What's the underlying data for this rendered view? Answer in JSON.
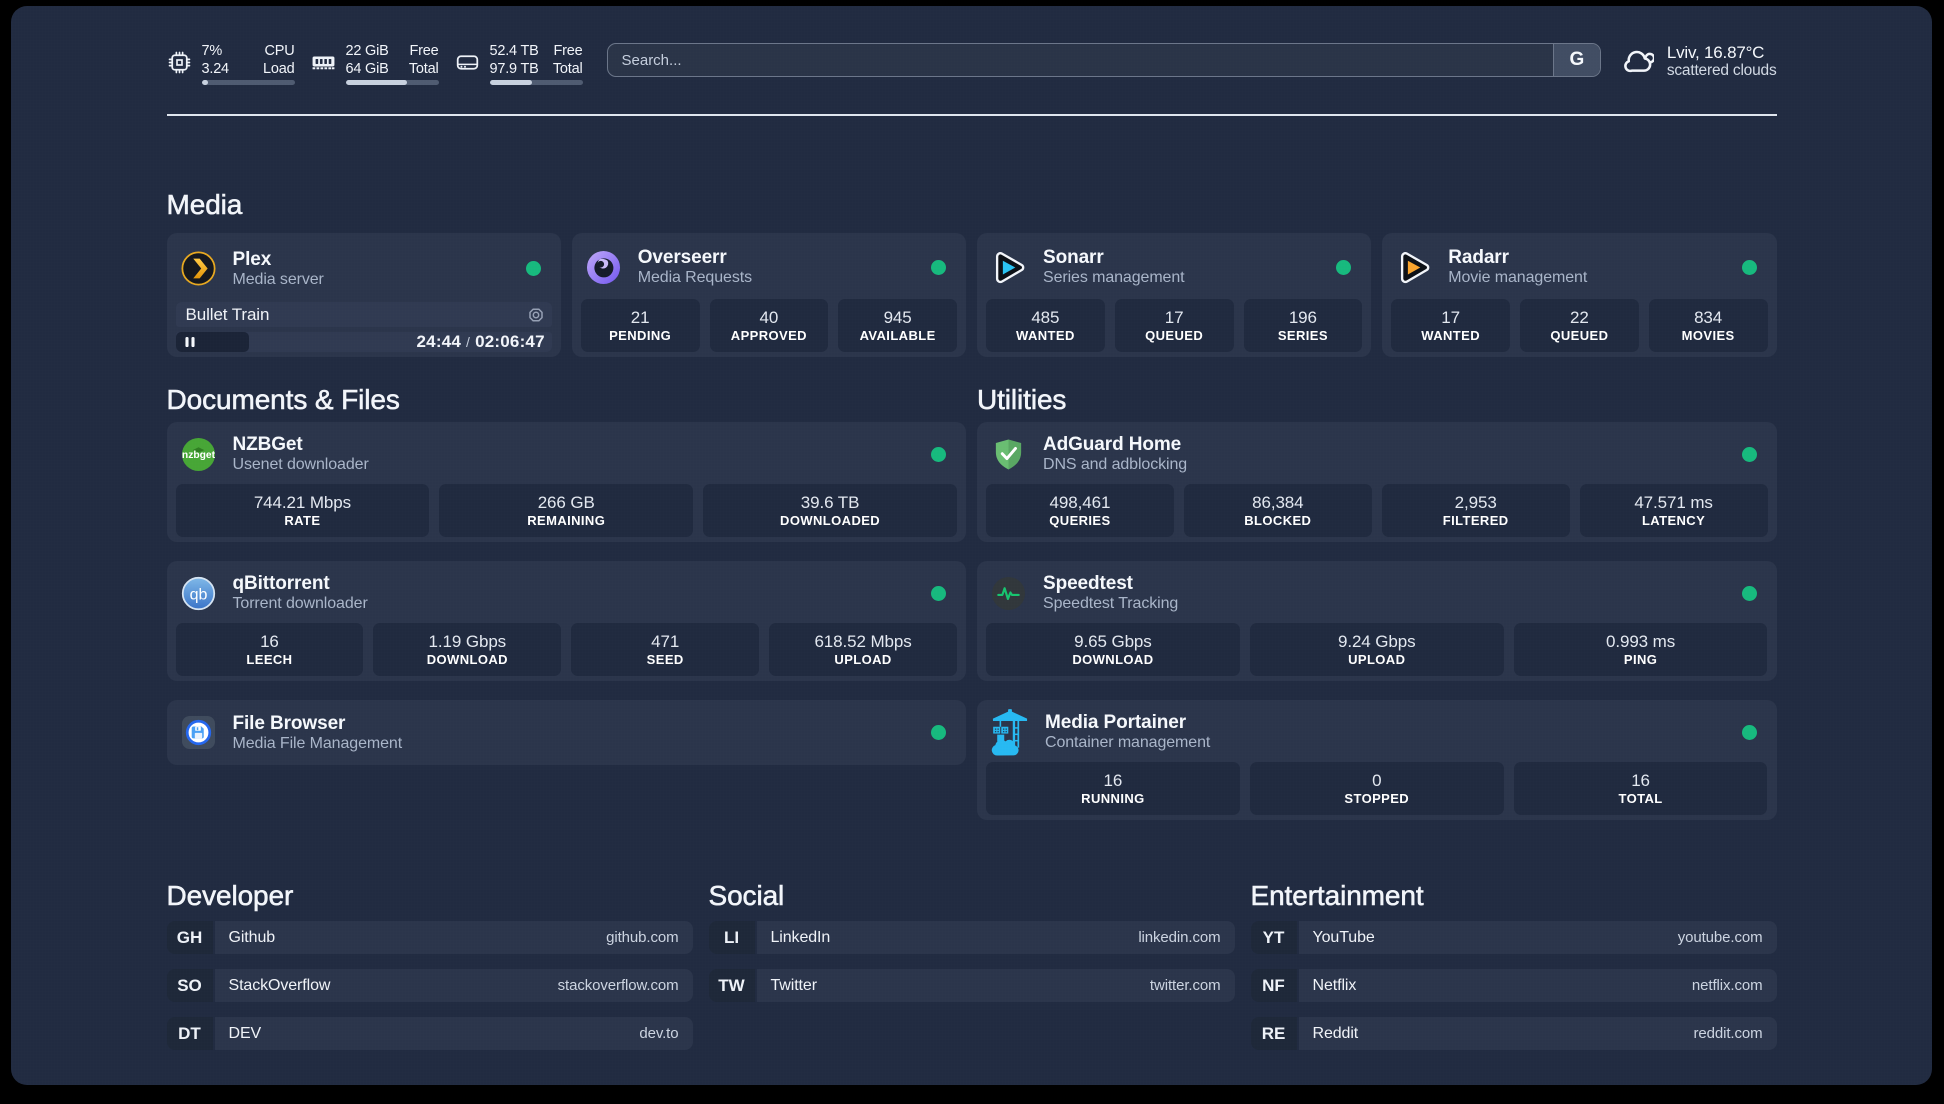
{
  "theme": {
    "status_green": "#17b97e",
    "page_bg": "#212b41",
    "card_bg": "#2b354b"
  },
  "topbar": {
    "cpu": {
      "icon": "cpu-icon",
      "values": [
        "7%",
        "3.24"
      ],
      "labels": [
        "CPU",
        "Load"
      ],
      "percent": 7
    },
    "memory": {
      "icon": "memory-icon",
      "values": [
        "22 GiB",
        "64 GiB"
      ],
      "labels": [
        "Free",
        "Total"
      ],
      "percent": 66
    },
    "disk": {
      "icon": "disk-icon",
      "values": [
        "52.4 TB",
        "97.9 TB"
      ],
      "labels": [
        "Free",
        "Total"
      ],
      "percent": 46
    },
    "search": {
      "placeholder": "Search...",
      "button_label": "G"
    },
    "weather": {
      "location_temp": "Lviv, 16.87°C",
      "condition": "scattered clouds"
    }
  },
  "media": {
    "title": "Media",
    "plex": {
      "name": "Plex",
      "description": "Media server",
      "now_playing": {
        "title": "Bullet Train",
        "position": "24:44",
        "separator": "/",
        "duration": "02:06:47",
        "percent": 19.5
      }
    },
    "overseerr": {
      "name": "Overseerr",
      "description": "Media Requests",
      "stats": [
        {
          "value": "21",
          "label": "PENDING"
        },
        {
          "value": "40",
          "label": "APPROVED"
        },
        {
          "value": "945",
          "label": "AVAILABLE"
        }
      ]
    },
    "sonarr": {
      "name": "Sonarr",
      "description": "Series management",
      "stats": [
        {
          "value": "485",
          "label": "WANTED"
        },
        {
          "value": "17",
          "label": "QUEUED"
        },
        {
          "value": "196",
          "label": "SERIES"
        }
      ]
    },
    "radarr": {
      "name": "Radarr",
      "description": "Movie management",
      "stats": [
        {
          "value": "17",
          "label": "WANTED"
        },
        {
          "value": "22",
          "label": "QUEUED"
        },
        {
          "value": "834",
          "label": "MOVIES"
        }
      ]
    }
  },
  "documents": {
    "title": "Documents & Files",
    "nzbget": {
      "name": "NZBGet",
      "description": "Usenet downloader",
      "stats": [
        {
          "value": "744.21 Mbps",
          "label": "RATE"
        },
        {
          "value": "266 GB",
          "label": "REMAINING"
        },
        {
          "value": "39.6 TB",
          "label": "DOWNLOADED"
        }
      ]
    },
    "qbittorrent": {
      "name": "qBittorrent",
      "description": "Torrent downloader",
      "stats": [
        {
          "value": "16",
          "label": "LEECH"
        },
        {
          "value": "1.19 Gbps",
          "label": "DOWNLOAD"
        },
        {
          "value": "471",
          "label": "SEED"
        },
        {
          "value": "618.52 Mbps",
          "label": "UPLOAD"
        }
      ]
    },
    "filebrowser": {
      "name": "File Browser",
      "description": "Media File Management"
    }
  },
  "utilities": {
    "title": "Utilities",
    "adguard": {
      "name": "AdGuard Home",
      "description": "DNS and adblocking",
      "stats": [
        {
          "value": "498,461",
          "label": "QUERIES"
        },
        {
          "value": "86,384",
          "label": "BLOCKED"
        },
        {
          "value": "2,953",
          "label": "FILTERED"
        },
        {
          "value": "47.571 ms",
          "label": "LATENCY"
        }
      ]
    },
    "speedtest": {
      "name": "Speedtest",
      "description": "Speedtest Tracking",
      "stats": [
        {
          "value": "9.65 Gbps",
          "label": "DOWNLOAD"
        },
        {
          "value": "9.24 Gbps",
          "label": "UPLOAD"
        },
        {
          "value": "0.993 ms",
          "label": "PING"
        }
      ]
    },
    "portainer": {
      "name": "Media Portainer",
      "description": "Container management",
      "stats": [
        {
          "value": "16",
          "label": "RUNNING"
        },
        {
          "value": "0",
          "label": "STOPPED"
        },
        {
          "value": "16",
          "label": "TOTAL"
        }
      ]
    }
  },
  "bookmarks": [
    {
      "title": "Developer",
      "items": [
        {
          "abbr": "GH",
          "name": "Github",
          "url": "github.com"
        },
        {
          "abbr": "SO",
          "name": "StackOverflow",
          "url": "stackoverflow.com"
        },
        {
          "abbr": "DT",
          "name": "DEV",
          "url": "dev.to"
        }
      ]
    },
    {
      "title": "Social",
      "items": [
        {
          "abbr": "LI",
          "name": "LinkedIn",
          "url": "linkedin.com"
        },
        {
          "abbr": "TW",
          "name": "Twitter",
          "url": "twitter.com"
        }
      ]
    },
    {
      "title": "Entertainment",
      "items": [
        {
          "abbr": "YT",
          "name": "YouTube",
          "url": "youtube.com"
        },
        {
          "abbr": "NF",
          "name": "Netflix",
          "url": "netflix.com"
        },
        {
          "abbr": "RE",
          "name": "Reddit",
          "url": "reddit.com"
        }
      ]
    }
  ]
}
